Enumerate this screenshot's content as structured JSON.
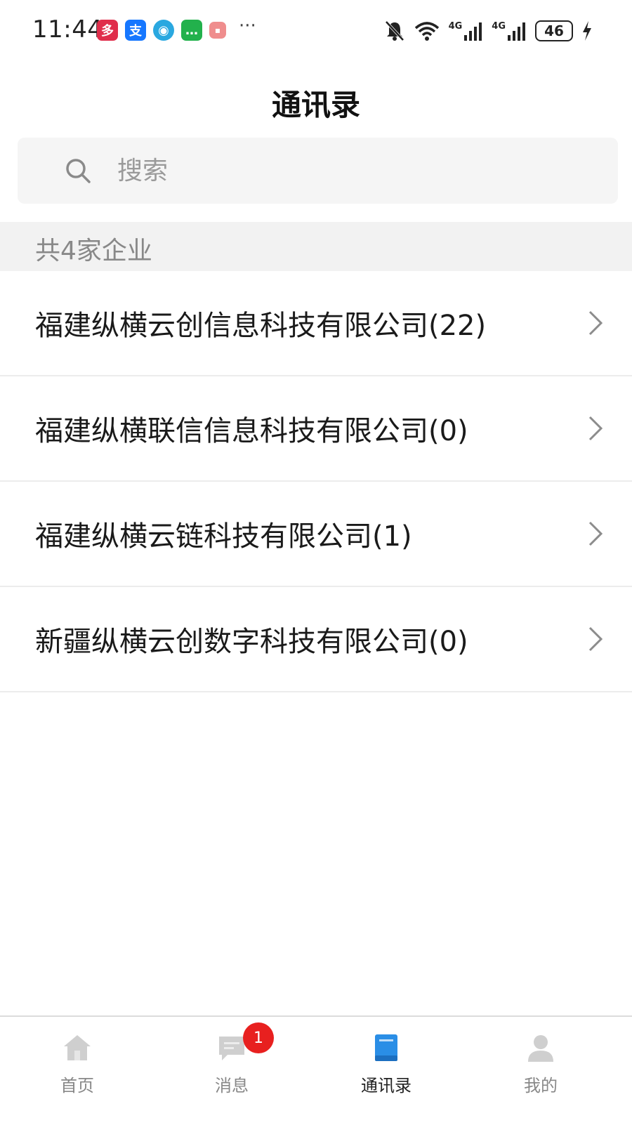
{
  "status_bar": {
    "time": "11:44",
    "apps": [
      {
        "icon": "pinduoduo-app-icon",
        "color": "#e02e4b",
        "glyph": "多"
      },
      {
        "icon": "alipay-app-icon",
        "color": "#1677ff",
        "glyph": "支"
      },
      {
        "icon": "browser-app-icon",
        "color": "#2aa8e0",
        "glyph": "◉"
      },
      {
        "icon": "wechat-app-icon",
        "color": "#22b14c",
        "glyph": "…"
      },
      {
        "icon": "red-app-icon",
        "color": "#ef8d8d",
        "glyph": "▪"
      }
    ],
    "more": "···",
    "net_1": "4G",
    "net_2": "4G",
    "battery": "46"
  },
  "header": {
    "title": "通讯录"
  },
  "search": {
    "placeholder": "搜索"
  },
  "section": {
    "count_label": "共4家企业"
  },
  "companies": [
    {
      "name": "福建纵横云创信息科技有限公司(22)"
    },
    {
      "name": "福建纵横联信信息科技有限公司(0)"
    },
    {
      "name": "福建纵横云链科技有限公司(1)"
    },
    {
      "name": "新疆纵横云创数字科技有限公司(0)"
    }
  ],
  "bottom_nav": {
    "items": [
      {
        "label": "首页",
        "icon": "home-icon"
      },
      {
        "label": "消息",
        "icon": "message-icon",
        "badge": "1"
      },
      {
        "label": "通讯录",
        "icon": "contacts-book-icon",
        "active": true
      },
      {
        "label": "我的",
        "icon": "profile-icon"
      }
    ]
  },
  "colors": {
    "accent": "#2a8ee6",
    "badge": "#e8201f",
    "muted_text": "#888888",
    "section_bg": "#f2f2f2"
  }
}
